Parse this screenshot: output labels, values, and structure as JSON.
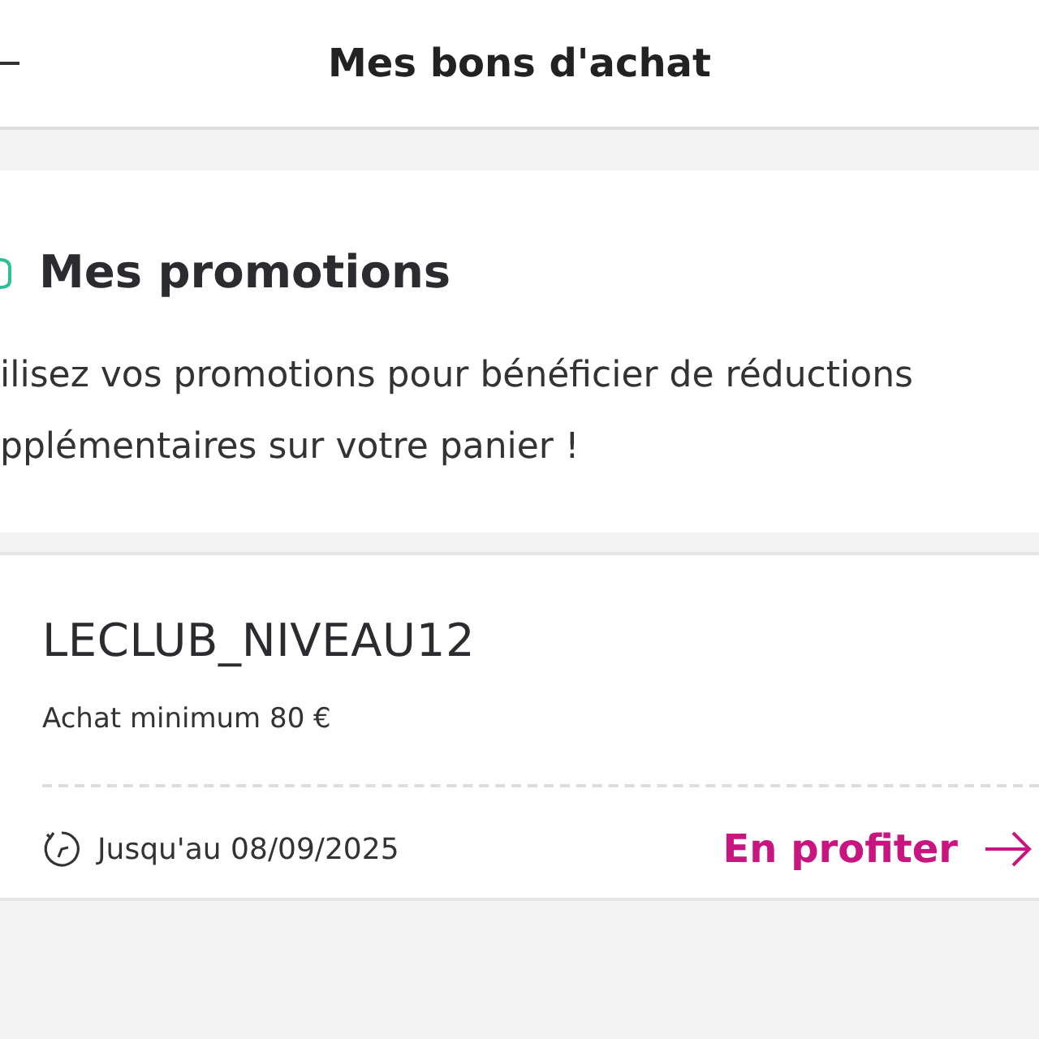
{
  "header": {
    "title": "Mes bons d'achat"
  },
  "promotions": {
    "title": "Mes promotions",
    "description": [
      "ilisez vos promotions pour bénéficier de réductions",
      "pplémentaires sur votre panier !"
    ]
  },
  "vouchers": [
    {
      "code": "LECLUB_NIVEAU12",
      "condition": "Achat minimum 80 €",
      "validity": "Jusqu'au 08/09/2025",
      "action": "En profiter"
    }
  ]
}
